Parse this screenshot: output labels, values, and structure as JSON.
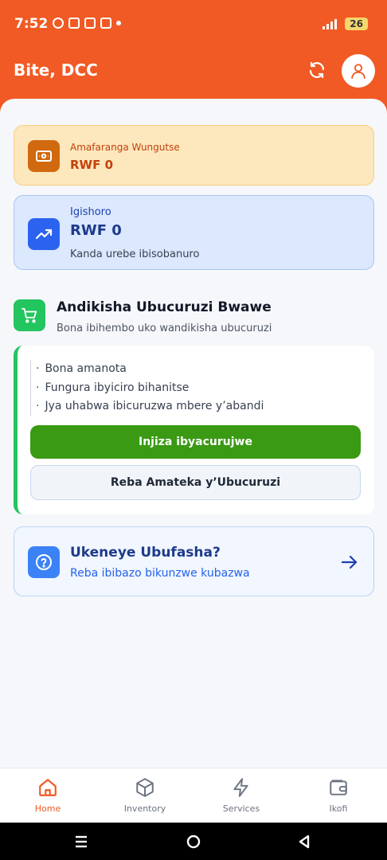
{
  "status_bar": {
    "time": "7:52",
    "battery": "26"
  },
  "header": {
    "title": "Bite, DCC"
  },
  "earnings_card": {
    "label": "Amafaranga Wungutse",
    "value": "RWF 0",
    "icon": "wallet-cash-icon"
  },
  "investment_card": {
    "label": "Igishoro",
    "value": "RWF 0",
    "subtitle": "Kanda urebe ibisobanuro",
    "icon": "trending-up-icon"
  },
  "business_section": {
    "title": "Andikisha Ubucuruzi Bwawe",
    "subtitle": "Bona ibihembo uko wandikisha ubucuruzi",
    "benefits": [
      "Bona amanota",
      "Fungura ibyiciro bihanitse",
      "Jya uhabwa ibicuruzwa mbere y’abandi"
    ],
    "primary_button": "Injiza ibyacurujwe",
    "secondary_button": "Reba Amateka y’Ubucuruzi"
  },
  "help_card": {
    "title": "Ukeneye Ubufasha?",
    "subtitle": "Reba ibibazo bikunzwe kubazwa"
  },
  "bottom_nav": {
    "items": [
      {
        "label": "Home",
        "icon": "home-icon",
        "active": true
      },
      {
        "label": "Inventory",
        "icon": "box-icon",
        "active": false
      },
      {
        "label": "Services",
        "icon": "lightning-icon",
        "active": false
      },
      {
        "label": "Ikofi",
        "icon": "wallet-icon",
        "active": false
      }
    ]
  },
  "colors": {
    "brand": "#f15a24",
    "success": "#3a9a13",
    "info": "#2b63f0"
  }
}
